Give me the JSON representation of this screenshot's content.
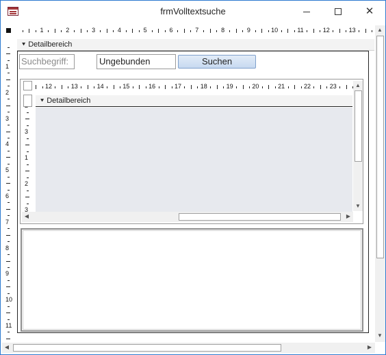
{
  "window": {
    "title": "frmVolltextsuche",
    "icon": "form-icon",
    "buttons": {
      "minimize": "minimize-icon",
      "maximize": "maximize-icon",
      "close": "✕"
    }
  },
  "ruler": {
    "horizontal": [
      "1",
      "2",
      "3",
      "4",
      "5",
      "6",
      "7",
      "8",
      "9",
      "10",
      "11",
      "12",
      "13"
    ],
    "vertical": [
      "1",
      "2",
      "3",
      "4",
      "5",
      "6",
      "7",
      "8",
      "9",
      "10",
      "11"
    ]
  },
  "sections": {
    "detail_label": "Detailbereich"
  },
  "search": {
    "label": "Suchbegriff:",
    "field_value": "Ungebunden",
    "button_label": "Suchen"
  },
  "subform": {
    "section_label": "Detailbereich",
    "hruler": [
      "12",
      "13",
      "14",
      "15",
      "16",
      "17",
      "18",
      "19",
      "20",
      "21",
      "22",
      "23"
    ],
    "vruler": [
      "2",
      "3",
      "1",
      "2",
      "3"
    ]
  },
  "colors": {
    "accent_border": "#2b79d0",
    "button_fill": "#c7d9f0",
    "detail_fill": "#e7e9ee"
  }
}
